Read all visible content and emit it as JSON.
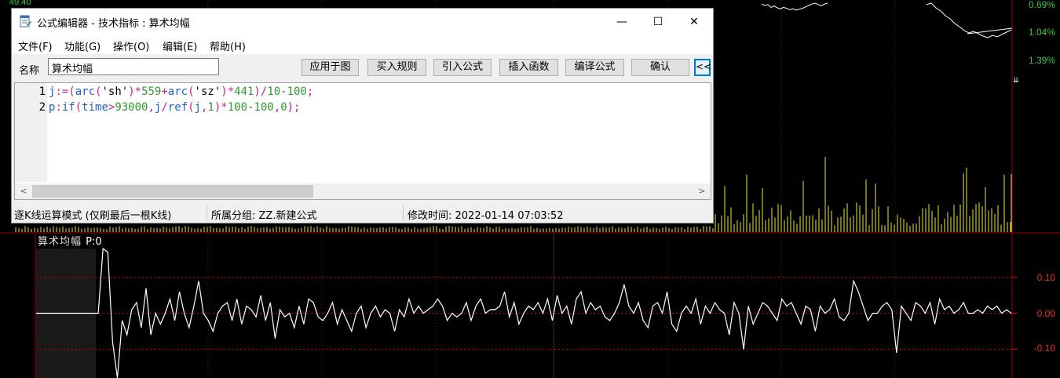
{
  "window": {
    "title": "公式编辑器 - 技术指标 : 算术均幅",
    "minimize_glyph": "—",
    "maximize_glyph": "☐",
    "close_glyph": "✕"
  },
  "menu": [
    "文件(F)",
    "功能(G)",
    "操作(O)",
    "编辑(E)",
    "帮助(H)"
  ],
  "toolbar": {
    "name_label": "名称",
    "name_value": "算术均幅",
    "buttons": [
      "应用于图",
      "买入规则",
      "引入公式",
      "插入函数",
      "编译公式",
      "确认"
    ],
    "collapse_glyph": "<<"
  },
  "code": {
    "line_numbers": [
      "1",
      "2"
    ],
    "lines": [
      [
        [
          "j",
          "c-var"
        ],
        [
          ":=(",
          "c-op"
        ],
        [
          "arc",
          "c-fn"
        ],
        [
          "(",
          "c-pun"
        ],
        [
          "'sh'",
          "c-str"
        ],
        [
          ")",
          "c-pun"
        ],
        [
          "*",
          "c-op"
        ],
        [
          "559",
          "c-num"
        ],
        [
          "+",
          "c-op"
        ],
        [
          "arc",
          "c-fn"
        ],
        [
          "(",
          "c-pun"
        ],
        [
          "'sz'",
          "c-str"
        ],
        [
          ")",
          "c-pun"
        ],
        [
          "*",
          "c-op"
        ],
        [
          "441",
          "c-num"
        ],
        [
          ")/",
          "c-op"
        ],
        [
          "10",
          "c-num"
        ],
        [
          "-",
          "c-op"
        ],
        [
          "100",
          "c-num"
        ],
        [
          ";",
          "c-pun"
        ]
      ],
      [
        [
          "p",
          "c-var"
        ],
        [
          ":",
          "c-op"
        ],
        [
          "if",
          "c-fn"
        ],
        [
          "(",
          "c-pun"
        ],
        [
          "time",
          "c-fn"
        ],
        [
          ">",
          "c-op"
        ],
        [
          "93000",
          "c-num"
        ],
        [
          ",",
          "c-pun"
        ],
        [
          "j",
          "c-var"
        ],
        [
          "/",
          "c-op"
        ],
        [
          "ref",
          "c-fn"
        ],
        [
          "(",
          "c-pun"
        ],
        [
          "j",
          "c-var"
        ],
        [
          ",",
          "c-pun"
        ],
        [
          "1",
          "c-num"
        ],
        [
          ")",
          "c-pun"
        ],
        [
          "*",
          "c-op"
        ],
        [
          "100",
          "c-num"
        ],
        [
          "-",
          "c-op"
        ],
        [
          "100",
          "c-num"
        ],
        [
          ",",
          "c-pun"
        ],
        [
          "0",
          "c-num"
        ],
        [
          ");",
          "c-pun"
        ]
      ]
    ]
  },
  "status": {
    "mode": "逐K线运算模式 (仅刷最后一根K线)",
    "group": "所属分组: ZZ.新建公式",
    "modified": "修改时间: 2022-01-14 07:03:52"
  },
  "chart": {
    "left_price": "49.40",
    "right_pct_labels": [
      "0.69%",
      "1.04%",
      "1.39%"
    ],
    "indicator_title": "算术均幅",
    "indicator_value_label": "P:0",
    "indicator_ticks": [
      "0.10",
      "0.00",
      "-0.10"
    ],
    "colors": {
      "price_up": "#2ecc40",
      "volume": "#e8e83a",
      "indicator_line": "#ffffff",
      "ref_line": "#cc0000",
      "tick": "#e03030"
    }
  },
  "chart_data": {
    "type": "line",
    "title": "算术均幅",
    "ylim": [
      -0.18,
      0.18
    ],
    "yticks": [
      0.1,
      0.0,
      -0.1
    ],
    "series": [
      {
        "name": "P",
        "values": [
          0,
          0,
          0,
          0,
          0,
          0,
          0,
          0,
          0,
          0,
          0,
          0,
          0,
          0,
          0.18,
          0.17,
          -0.08,
          -0.18,
          -0.02,
          -0.06,
          0.01,
          0.03,
          -0.04,
          0.07,
          -0.06,
          0.0,
          -0.03,
          0.0,
          0.04,
          -0.02,
          0.06,
          0.0,
          -0.04,
          0.02,
          0.09,
          0.0,
          -0.02,
          -0.05,
          0.0,
          0.02,
          0.03,
          -0.02,
          0.04,
          -0.03,
          0.02,
          0.01,
          -0.01,
          0.05,
          -0.02,
          0.03,
          -0.07,
          0.01,
          -0.01,
          0.0,
          -0.04,
          0.02,
          -0.03,
          0.04,
          0.03,
          -0.01,
          -0.02,
          0.0,
          0.03,
          -0.03,
          0.01,
          -0.02,
          -0.05,
          0.0,
          0.02,
          -0.04,
          0.0,
          0.02,
          -0.01,
          0.01,
          0.0,
          -0.05,
          0.01,
          -0.01,
          0.04,
          0.0,
          0.02,
          0.0,
          0.01,
          0.02,
          0.04,
          0.02,
          -0.02,
          0.0,
          -0.01,
          0.0,
          0.03,
          -0.02,
          0.02,
          0.04,
          0.0,
          0.01,
          0.01,
          0.02,
          0.06,
          -0.01,
          0.03,
          -0.03,
          0.0,
          0.02,
          0.01,
          0.03,
          0.0,
          0.04,
          -0.02,
          0.05,
          0.0,
          0.02,
          -0.03,
          0.04,
          0.06,
          0.0,
          0.03,
          0.01,
          0.02,
          -0.01,
          -0.02,
          0.0,
          0.03,
          0.08,
          0.02,
          0.0,
          0.03,
          -0.02,
          -0.04,
          0.02,
          0.03,
          0.0,
          0.06,
          -0.03,
          -0.05,
          0.0,
          0.02,
          0.0,
          0.04,
          -0.03,
          0.02,
          0.0,
          0.03,
          0.01,
          0.0,
          -0.06,
          0.03,
          0.0,
          -0.1,
          0.02,
          -0.03,
          0.0,
          0.03,
          0.02,
          0.0,
          -0.02,
          0.04,
          0.02,
          0.03,
          0.0,
          -0.03,
          0.02,
          0.01,
          -0.05,
          0.02,
          0.0,
          0.01,
          0.04,
          -0.01,
          -0.02,
          0.0,
          0.09,
          0.06,
          0.02,
          -0.02,
          0.0,
          0.0,
          0.02,
          0.03,
          0.01,
          -0.11,
          0.02,
          0.0,
          -0.02,
          0.03,
          0.02,
          0.0,
          0.03,
          -0.03,
          0.04,
          0.01,
          0.02,
          0.0,
          0.01,
          0.03,
          0.0,
          0.0,
          0.01,
          0.0,
          0.02,
          0.01,
          0.02,
          0.0,
          0.01,
          0.0
        ]
      }
    ]
  }
}
